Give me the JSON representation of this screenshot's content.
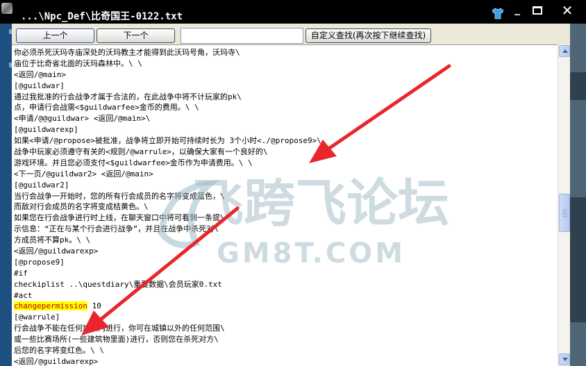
{
  "window": {
    "title": "...\\Npc_Def\\比奇国王-0122.txt"
  },
  "toolbar": {
    "prev_label": "上一个",
    "next_label": "下一个",
    "search_value": "",
    "find_label": "自定义查找(再次按下继续查找)"
  },
  "editor": {
    "lines": [
      "你必须杀死沃玛寺庙深处的沃玛教主才能得到此沃玛号角，沃玛寺\\",
      "庙位于比奇省北面的沃玛森林中。\\ \\",
      "<返回/@main>",
      "[@guildwar]",
      "通过我批准的行会战争才属于合法的，在此战争中将不计玩家的pk\\",
      "点，申请行会战需<$guildwarfee>金币的费用。\\ \\",
      "<申请/@@guildwar> <返回/@main>\\",
      "[@guildwarexp]",
      "如果<申请/@propose>被批准，战争将立即开始可持续时长为 3个小时<./@propose9>\\",
      "战争中玩家必须遵守有关的<规则/@warrule>，以确保大家有一个良好的\\",
      "游戏环境。并且您必须支付<$guildwarfee>金币作为申请费用。\\ \\",
      "<下一页/@guildwar2> <返回/@main>",
      "[@guildwar2]",
      "当行会战争一开始时，您的所有行会成员的名字将变成蓝色，\\",
      "而敌对行会成员的名字将变成桔黄色。\\",
      "如果您在行会战争进行时上线，在聊天窗口中将可看到一条提\\",
      "示信息：“正在与某个行会进行战争”，并且在战争中杀死对\\",
      "方成员将不算pk。\\ \\",
      "<返回/@guildwarexp>",
      "[@propose9]",
      "#if",
      "checkiplist ..\\questdiary\\重要数据\\会员玩家0.txt",
      "#act",
      "changepermission 10",
      "[@warrule]",
      "行会战争不能在任何城镇内进行，你可在城镇以外的任何范围\\",
      "或一些比赛场所(一些建筑物里面)进行，否则您在杀死对方\\",
      "后您的名字将变红色。\\ \\",
      "<返回/@guildwarexp>"
    ],
    "highlight_text": "changepermission",
    "highlight_rest": " 10"
  },
  "watermark": {
    "main_text": "飞跨飞论坛",
    "sub_text": "GM8T.COM",
    "color": "#9fb8c4"
  },
  "colors": {
    "title_bg": "#000000",
    "window_bg": "#ece9d8",
    "highlight_bg": "#ffff00",
    "highlight_fg": "#c00000",
    "arrow": "#e8262c"
  }
}
